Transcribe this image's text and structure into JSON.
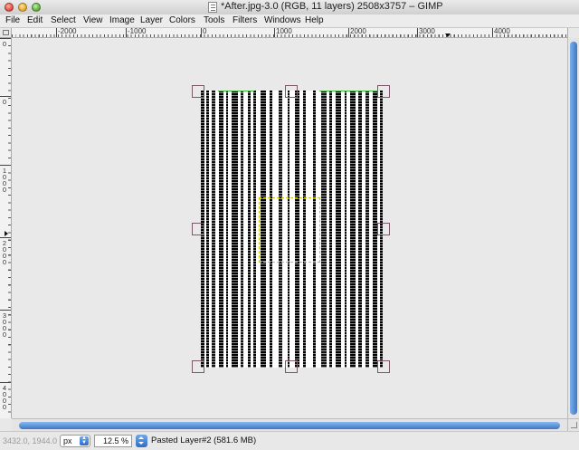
{
  "window": {
    "title": "*After.jpg-3.0 (RGB, 11 layers) 2508x3757 – GIMP"
  },
  "menu": [
    {
      "label": "File"
    },
    {
      "label": "Edit"
    },
    {
      "label": "Select"
    },
    {
      "label": "View"
    },
    {
      "label": "Image"
    },
    {
      "label": "Layer"
    },
    {
      "label": "Colors"
    },
    {
      "label": "Tools"
    },
    {
      "label": "Filters"
    },
    {
      "label": "Windows"
    },
    {
      "label": "Help"
    }
  ],
  "hruler": {
    "labels": [
      "-2000",
      "-1000",
      "0",
      "1000",
      "2000",
      "3000",
      "4000"
    ]
  },
  "vruler": {
    "labels": [
      "0",
      "0",
      "1000",
      "2000",
      "3000",
      "4000"
    ]
  },
  "colors": {
    "scroll_thumb": "#3a78c8",
    "selection": "#c8c800",
    "layer_boundary": "#3fbf3f",
    "handle": "#7a5a6a"
  },
  "status": {
    "coords": "3432.0, 1944.0",
    "unit": "px",
    "zoom": "12.5 %",
    "message": "Pasted Layer#2 (581.6 MB)"
  }
}
